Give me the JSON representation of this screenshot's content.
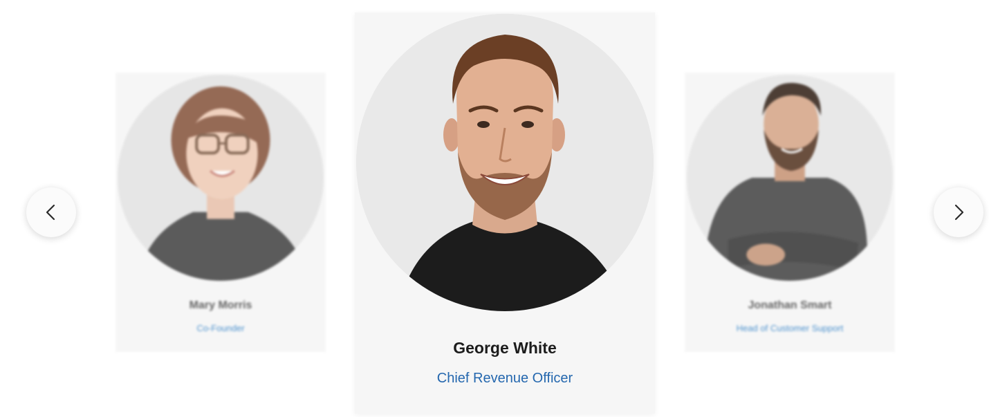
{
  "carousel": {
    "prev_icon": "chevron-left-icon",
    "next_icon": "chevron-right-icon",
    "members": [
      {
        "name": "Mary Morris",
        "role": "Co-Founder"
      },
      {
        "name": "George White",
        "role": "Chief Revenue Officer"
      },
      {
        "name": "Jonathan Smart",
        "role": "Head of Customer Support"
      }
    ]
  },
  "colors": {
    "card_bg": "#f6f6f6",
    "role_blue": "#2467ae",
    "name_dark": "#1c1c1c"
  }
}
